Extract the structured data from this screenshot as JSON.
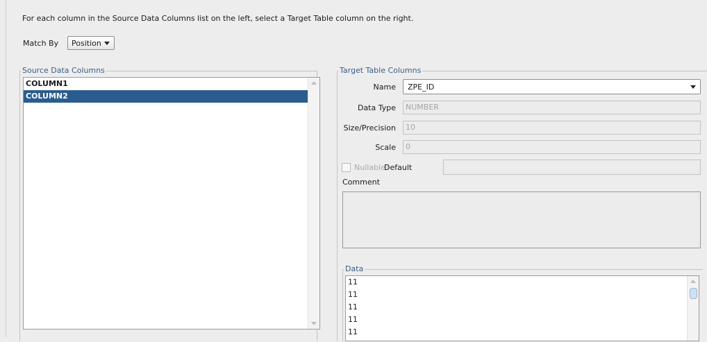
{
  "instruction": "For each column in the Source Data Columns list on the left, select a Target Table column on the right.",
  "match_by": {
    "label": "Match By",
    "value": "Position"
  },
  "source": {
    "title": "Source Data Columns",
    "items": [
      {
        "label": "COLUMN1",
        "selected": false
      },
      {
        "label": "COLUMN2",
        "selected": true
      }
    ]
  },
  "target": {
    "title": "Target Table Columns",
    "name_label": "Name",
    "name_value": "ZPE_ID",
    "data_type_label": "Data Type",
    "data_type_value": "NUMBER",
    "size_label": "Size/Precision",
    "size_value": "10",
    "scale_label": "Scale",
    "scale_value": "0",
    "nullable_label": "Nullable?",
    "default_label": "Default",
    "default_value": "",
    "comment_label": "Comment",
    "comment_value": ""
  },
  "data": {
    "title": "Data",
    "rows": [
      "11",
      "11",
      "11",
      "11",
      "11"
    ]
  },
  "colors": {
    "selection": "#2b5c8f",
    "group_title": "#3b5f86"
  }
}
